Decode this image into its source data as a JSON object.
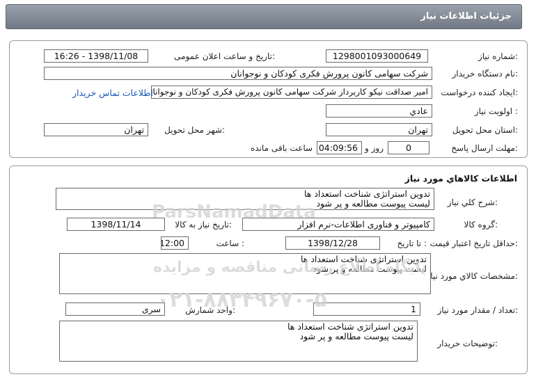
{
  "header": {
    "title": "جزئيات اطلاعات نياز"
  },
  "info": {
    "need_number_label": "شماره نياز:",
    "need_number": "1298001093000649",
    "announce_label": "تاريخ و ساعت اعلان عمومی:",
    "announce_value": "1398/11/08 - 16:26",
    "buyer_org_label": "نام دستگاه خريدار:",
    "buyer_org": "شرکت سهامی کانون پرورش فکری کودکان و نوجوانان",
    "creator_label": "ايجاد کننده درخواست:",
    "creator": "امير صداقت نيکو کاربرداز شرکت سهامی کانون پرورش فکری کودکان و نوجوانان",
    "contact_link": "اطلاعات تماس خريدار",
    "priority_label": "اولويت نياز :",
    "priority": "عادي",
    "province_label": "استان محل تحويل:",
    "province": "تهران",
    "city_label": "شهر محل تحويل:",
    "city": "تهران",
    "deadline_label": "مهلت ارسال پاسخ:",
    "deadline_days": "0",
    "deadline_day_word": "روز و",
    "deadline_time": "04:09:56",
    "deadline_remaining": "ساعت باقی مانده"
  },
  "goods": {
    "section_title": "اطلاعات کالاهاي مورد نياز",
    "summary_label": "شرح کلي نياز:",
    "summary_line1": "تدوين استراتژی شناخت استعداد ها",
    "summary_line2": "ليست پيوست مطالعه و پر شود",
    "group_label": "گروه کالا:",
    "group": "کامپيوتر و فناوری اطلاعات-نرم افزار",
    "need_date_label": "تاريخ نياز به کالا:",
    "need_date": "1398/11/14",
    "validity_label": "حداقل تاريخ اعتبار قيمت:",
    "validity_to_label": "تا تاريخ :",
    "validity_date": "1398/12/28",
    "validity_time_label": "ساعت :",
    "validity_time": "12:00",
    "specs_label": "مشخصات کالاي مورد نياز:",
    "specs_line1": "تدوين استراتژی شناخت استعداد ها",
    "specs_line2": "ليست پيوست مطالعه و پر شود",
    "qty_label": "تعداد / مقدار مورد نياز:",
    "qty": "1",
    "unit_label": "واحد شمارش:",
    "unit": "سری",
    "buyer_notes_label": "توضيحات خريدار:",
    "notes_line1": "تدوين استراتژی شناخت استعداد ها",
    "notes_line2": "ليست پيوست مطالعه و پر شود"
  },
  "watermark": {
    "brand": "ParsNamadData",
    "site_text": "پايگاه اطلاع رسانی مناقصه و مزايده",
    "phone": "۰۲۱-۸۸۳۴۹۶۷۰-۵"
  }
}
